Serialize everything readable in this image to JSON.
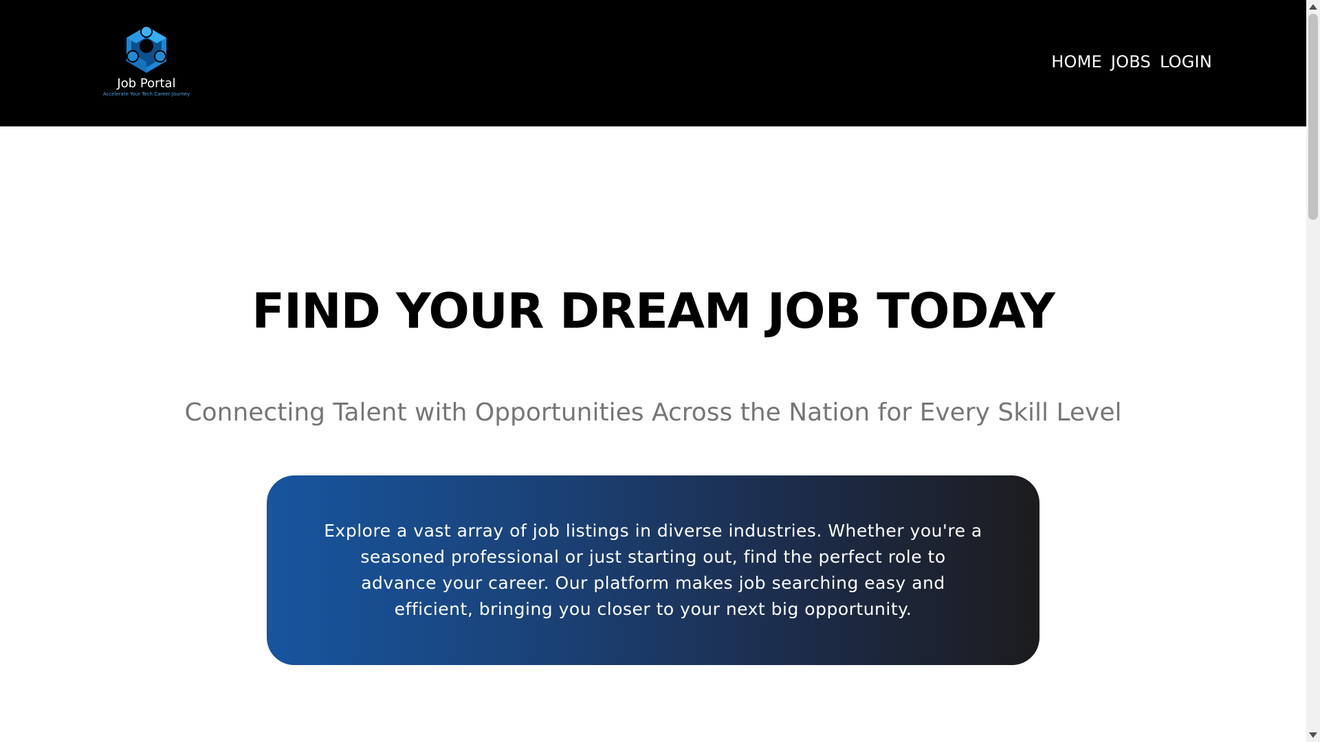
{
  "header": {
    "logo": {
      "name": "Job Portal",
      "tagline": "Accelerate Your Tech Career Journey",
      "icon": "hexagon-network-logo-icon"
    },
    "nav": [
      {
        "label": "HOME"
      },
      {
        "label": "JOBS"
      },
      {
        "label": "LOGIN"
      }
    ]
  },
  "hero": {
    "title": "FIND YOUR DREAM JOB TODAY",
    "subtitle": "Connecting Talent with Opportunities Across the Nation for Every Skill Level",
    "card_text": "Explore a vast array of job listings in diverse industries. Whether you're a seasoned professional or just starting out, find the perfect role to advance your career. Our platform makes job searching easy and efficient, bringing you closer to your next big opportunity."
  },
  "colors": {
    "navbar": "#000000",
    "card_gradient_start": "#17559f",
    "card_gradient_end": "#1c1c1e",
    "subtitle": "#767676",
    "logo_blue": "#2196e0"
  }
}
